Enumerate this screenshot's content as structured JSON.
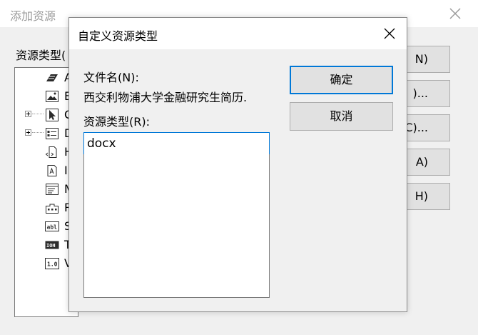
{
  "background_dialog": {
    "title": "添加资源",
    "resource_type_label": "资源类型(",
    "tree_items": [
      {
        "label": "A",
        "icon": "accelerator-icon",
        "expandable": false
      },
      {
        "label": "B",
        "icon": "bitmap-icon",
        "expandable": false
      },
      {
        "label": "C",
        "icon": "cursor-icon",
        "expandable": true
      },
      {
        "label": "D",
        "icon": "dialog-icon",
        "expandable": true
      },
      {
        "label": "H",
        "icon": "html-icon",
        "expandable": false
      },
      {
        "label": "I",
        "icon": "icon-resource-icon",
        "expandable": false
      },
      {
        "label": "M",
        "icon": "menu-icon",
        "expandable": false
      },
      {
        "label": "R",
        "icon": "ribbon-icon",
        "expandable": false
      },
      {
        "label": "S",
        "icon": "string-table-icon",
        "expandable": false
      },
      {
        "label": "T",
        "icon": "toolbar-icon",
        "expandable": false
      },
      {
        "label": "V",
        "icon": "version-icon",
        "expandable": false
      }
    ],
    "buttons": [
      "N)",
      ")...",
      "C)...",
      "A)",
      "H)"
    ]
  },
  "dialog": {
    "title": "自定义资源类型",
    "filename_label": "文件名(N):",
    "filename_value": "西交利物浦大学金融研究生简历.",
    "resource_type_label": "资源类型(R):",
    "resource_type_value": "docx",
    "ok_label": "确定",
    "cancel_label": "取消"
  },
  "colors": {
    "accent": "#0078d7",
    "window_bg": "#f0f0f0",
    "button_bg": "#e1e1e1"
  }
}
